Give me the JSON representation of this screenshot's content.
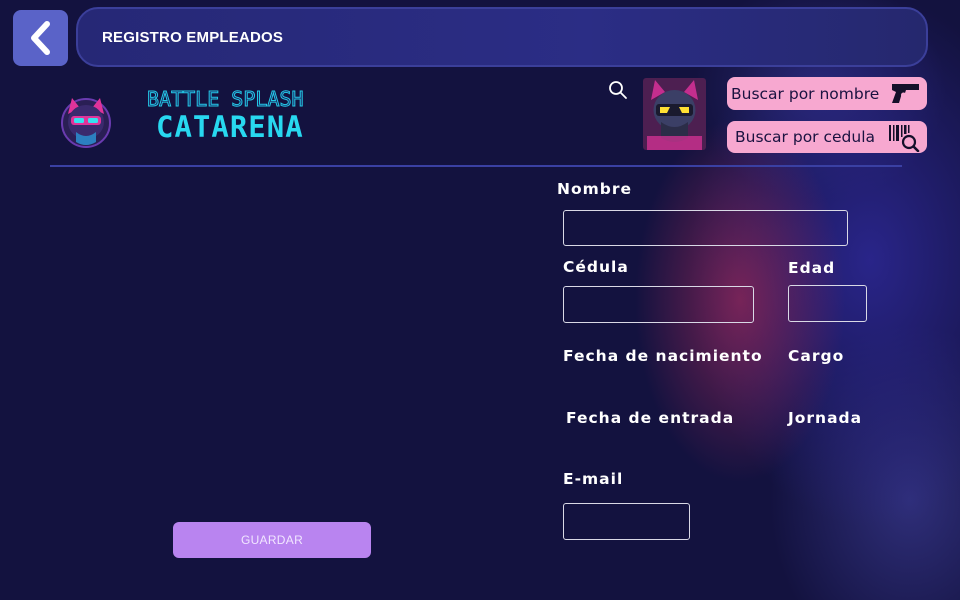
{
  "header": {
    "title": "REGISTRO EMPLEADOS"
  },
  "brand": {
    "top": "BATTLE SPLASH",
    "main": "CATARENA"
  },
  "toolbar": {
    "buscar_nombre": "Buscar por nombre",
    "buscar_cedula": "Buscar por cedula"
  },
  "form": {
    "nombre": {
      "label": "Nombre",
      "value": ""
    },
    "cedula": {
      "label": "Cédula",
      "value": ""
    },
    "edad": {
      "label": "Edad",
      "value": ""
    },
    "fecha_nacimiento": {
      "label": "Fecha de nacimiento"
    },
    "cargo": {
      "label": "Cargo"
    },
    "fecha_entrada": {
      "label": "Fecha de entrada"
    },
    "jornada": {
      "label": "Jornada"
    },
    "email": {
      "label": "E-mail",
      "value": ""
    }
  },
  "actions": {
    "save_label": "GUARDAR"
  },
  "icons": {
    "back": "chevron-left-icon",
    "search": "search-icon",
    "gun": "pistol-icon",
    "barcode": "barcode-search-icon"
  },
  "colors": {
    "background": "#13123f",
    "accent_button": "#5a63c8",
    "pill": "#f7a8d0",
    "save": "#b984f0",
    "brand_cyan": "#28d8f0"
  }
}
